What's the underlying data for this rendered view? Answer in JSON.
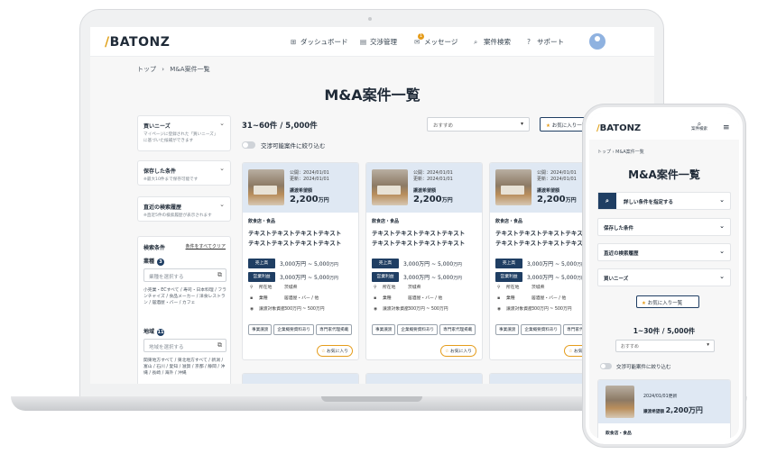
{
  "brand": {
    "logo": "BATONZ",
    "slash": "/"
  },
  "nav": [
    {
      "icon": "dashboard-icon",
      "glyph": "⊞",
      "label": "ダッシュボード"
    },
    {
      "icon": "clipboard-icon",
      "glyph": "▤",
      "label": "交渉管理"
    },
    {
      "icon": "mail-icon",
      "glyph": "✉",
      "label": "メッセージ",
      "badge": "1"
    },
    {
      "icon": "search-icon",
      "glyph": "⌕",
      "label": "案件検索"
    },
    {
      "icon": "help-icon",
      "glyph": "?",
      "label": "サポート"
    }
  ],
  "breadcrumb": {
    "home": "トップ",
    "sep": "›",
    "current": "M&A案件一覧"
  },
  "page_title": "M&A案件一覧",
  "sidebar": {
    "needs": {
      "title": "買いニーズ",
      "desc": "マイページに登録された「買いニーズ」に基づいた候補ができます"
    },
    "saved": {
      "title": "保存した条件",
      "desc": "※最大10件まで保存可能です"
    },
    "history": {
      "title": "直近の検索履歴",
      "desc": "※直近5件の検索履歴が表示されます"
    },
    "filter": {
      "title": "検索条件",
      "clear": "条件をすべてクリア",
      "industry": {
        "label": "業種",
        "badge": "3",
        "placeholder": "業種を選択する",
        "desc": "小売業・ECすべて / 寿司・日本料理 / フランチャイズ / 食品メーカー / 洋食レストラン / 居酒屋・バー / カフェ"
      },
      "region": {
        "label": "地域",
        "badge": "11",
        "placeholder": "地域を選択する",
        "desc": "関東地方すべて / 東北地方すべて / 新潟 / 富山 / 石川 / 愛知 / 滋賀 / 京都 / 静岡 / 沖縄 / 長崎 / 海外 / 沖縄"
      }
    }
  },
  "results": {
    "count": "31~60件 / 5,000件",
    "toggle_label": "交渉可能案件に絞り込む",
    "sort_placeholder": "おすすめ",
    "fav_button": "お気に入り一覧"
  },
  "card": {
    "published": "公開：2024/01/01",
    "updated": "更新：2024/01/01",
    "price_label": "譲渡希望額",
    "price": "2,200",
    "price_unit": "万円",
    "category": "飲食店・食品",
    "title_line1": "テキストテキストテキストテキスト",
    "title_line2": "テキストテキストテキストテキスト",
    "sales_tag": "売上高",
    "sales_value": "3,000万円 ~ 5,000",
    "profit_tag": "営業利益",
    "profit_value": "3,000万円 ~ 5,000",
    "unit": "万円",
    "location_key": "所在地",
    "location_val": "茨城県",
    "industry_key": "業種",
    "industry_val": "居酒屋・バー / 他",
    "asset_key": "譲渡対象資産",
    "asset_val": "300万円 ~ 500万円",
    "chips": [
      "事業譲渡",
      "企業概要資料あり",
      "専門家代理掲載"
    ],
    "fav": "お気に入り"
  },
  "phone": {
    "logo": "BATONZ",
    "search_label": "案件",
    "search_sub": "検索",
    "breadcrumb": "トップ  ›  M&A案件一覧",
    "title": "M&A案件一覧",
    "rows": [
      "詳しい条件を指定する",
      "保存した条件",
      "直近の検索履歴",
      "買いニーズ"
    ],
    "fav_button": "お気に入り一覧",
    "count": "1~30件 / 5,000件",
    "sort_placeholder": "おすすめ",
    "toggle_label": "交渉可能案件に絞り込む",
    "card_updated": "2024/01/01更新",
    "card_price_label": "譲渡希望額",
    "card_price": "2,200万円",
    "card_category": "飲食店・食品"
  }
}
